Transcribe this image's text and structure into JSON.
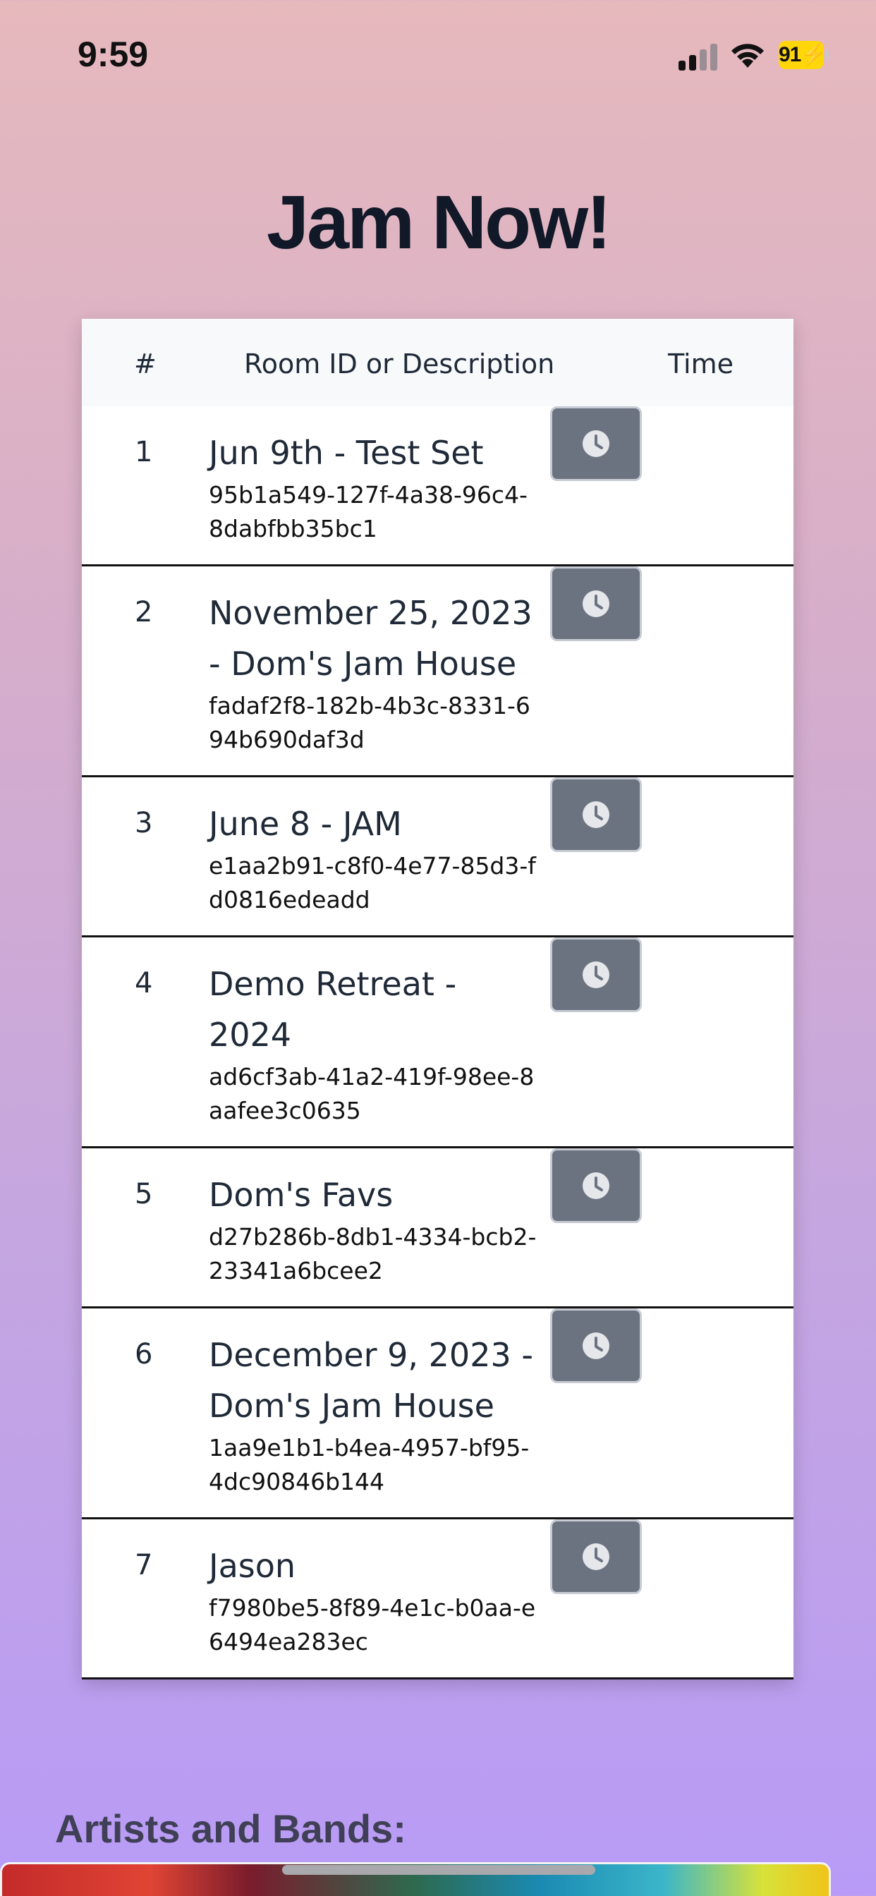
{
  "status_bar": {
    "time": "9:59",
    "battery": "91"
  },
  "page": {
    "title": "Jam Now!"
  },
  "table": {
    "headers": {
      "number": "#",
      "description": "Room ID or Description",
      "time": "Time"
    },
    "rows": [
      {
        "number": "1",
        "title": "Jun 9th - Test Set",
        "room_id": "95b1a549-127f-4a38-96c4-8dabfbb35bc1"
      },
      {
        "number": "2",
        "title": "November 25, 2023 - Dom's Jam House",
        "room_id": "fadaf2f8-182b-4b3c-8331-694b690daf3d"
      },
      {
        "number": "3",
        "title": "June 8 - JAM",
        "room_id": "e1aa2b91-c8f0-4e77-85d3-fd0816edeadd"
      },
      {
        "number": "4",
        "title": "Demo Retreat - 2024",
        "room_id": "ad6cf3ab-41a2-419f-98ee-8aafee3c0635"
      },
      {
        "number": "5",
        "title": "Dom's Favs",
        "room_id": "d27b286b-8db1-4334-bcb2-23341a6bcee2"
      },
      {
        "number": "6",
        "title": "December 9, 2023 - Dom's Jam House",
        "room_id": "1aa9e1b1-b4ea-4957-bf95-4dc90846b144"
      },
      {
        "number": "7",
        "title": "Jason",
        "room_id": "f7980be5-8f89-4e1c-b0aa-e6494ea283ec"
      }
    ]
  },
  "artists": {
    "heading": "Artists and Bands:"
  },
  "colors": {
    "time_button": "#6b7280",
    "battery": "#ffd60a",
    "title": "#111827"
  },
  "icons": {
    "time_button": "clock-icon"
  }
}
